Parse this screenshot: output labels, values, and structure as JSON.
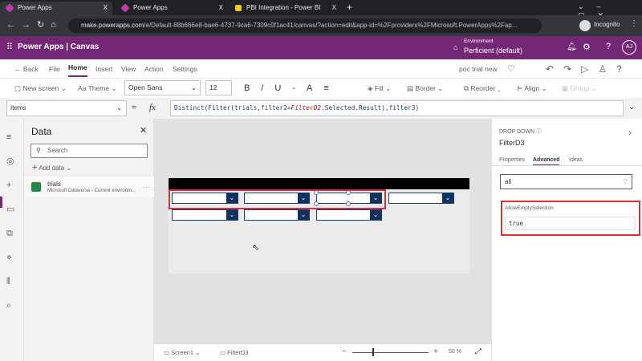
{
  "browser": {
    "tabs": [
      {
        "label": "Power Apps",
        "close": "X"
      },
      {
        "label": "Power Apps",
        "close": "X"
      },
      {
        "label": "PBI Integration - Power BI",
        "close": "X"
      }
    ],
    "new_tab": "+",
    "url_host": "make.powerapps.com",
    "url_path": "/e/Default-88b666e8-bae6-4737-9ca6-7309c0f1ac41/canvas/?action=edit&app-id=%2Fproviders%2FMicrosoft.PowerApps%2Fap...",
    "incognito": "Incognito"
  },
  "header": {
    "title": "Power Apps | Canvas",
    "env_label": "Environment",
    "env_name": "Perficient (default)",
    "avatar": "AJ"
  },
  "menu": {
    "back": "Back",
    "items": [
      "File",
      "Home",
      "Insert",
      "View",
      "Action",
      "Settings"
    ],
    "active": "Home",
    "app_name": "poc trial new"
  },
  "toolbar": {
    "new_screen": "New screen",
    "theme": "Theme",
    "font": "Open Sans",
    "font_size": "12",
    "fill": "Fill",
    "border": "Border",
    "reorder": "Reorder",
    "align": "Align",
    "group": "Group"
  },
  "formula": {
    "property": "Items",
    "equals": "=",
    "fx": "fx",
    "text_a": "Distinct(Filter(trials,filter2=",
    "text_b": "FilterD2",
    "text_c": ".Selected.Result),filter3)"
  },
  "data_pane": {
    "title": "Data",
    "search_placeholder": "Search",
    "add_data": "Add data",
    "source_name": "trials",
    "source_desc": "Microsoft Dataverse - Current environm..."
  },
  "properties": {
    "type": "DROP DOWN",
    "control": "FilterD3",
    "tabs": [
      "Properties",
      "Advanced",
      "Ideas"
    ],
    "active_tab": "Advanced",
    "search_value": "all",
    "prop_name": "AllowEmptySelection",
    "prop_value": "true"
  },
  "status": {
    "screen": "Screen1",
    "control": "FilterD3",
    "zoom": "50",
    "zoom_unit": "%"
  },
  "colors": {
    "brand": "#742774",
    "highlight": "#d13438",
    "dropdown": "#0f3260"
  }
}
